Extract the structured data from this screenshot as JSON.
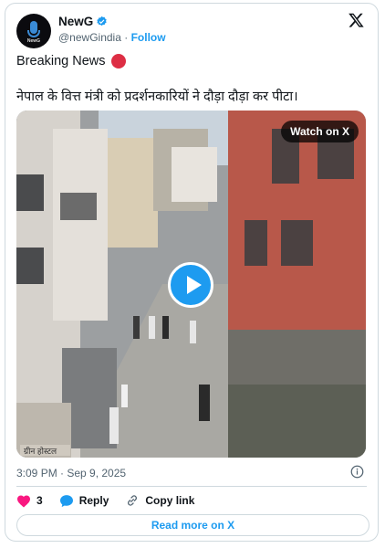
{
  "author": {
    "name": "NewG",
    "handle": "@newGindia",
    "separator": "·",
    "follow_label": "Follow",
    "avatar_text": "NewG"
  },
  "tweet": {
    "line1": "Breaking News",
    "line2": "नेपाल के वित्त मंत्री को प्रदर्शनकारियों ने दौड़ा दौड़ा कर पीटा।"
  },
  "media": {
    "watch_label": "Watch on X",
    "sign_text": "ग्रीन होस्टल"
  },
  "meta": {
    "timestamp": "3:09 PM · Sep 9, 2025"
  },
  "actions": {
    "like_count": "3",
    "reply_label": "Reply",
    "copy_label": "Copy link",
    "read_more_label": "Read more on X"
  },
  "colors": {
    "accent": "#1d9bf0",
    "like": "#f91880",
    "red_dot": "#dd2e44",
    "text": "#0f1419",
    "muted": "#536471"
  },
  "icons": [
    "verified-icon",
    "x-logo-icon",
    "red-circle-icon",
    "play-icon",
    "info-icon",
    "heart-icon",
    "reply-icon",
    "link-icon"
  ]
}
